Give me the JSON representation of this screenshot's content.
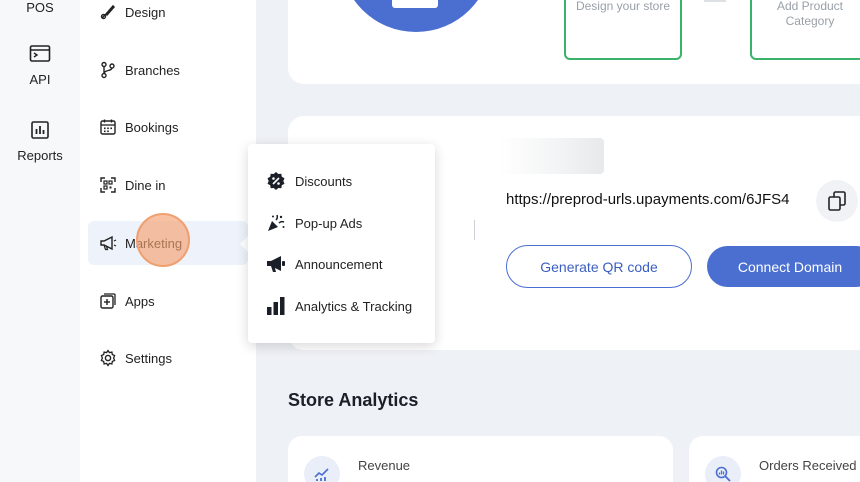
{
  "rail": {
    "items": [
      {
        "label": "POS",
        "icon": "pos-icon"
      },
      {
        "label": "API",
        "icon": "terminal-icon"
      },
      {
        "label": "Reports",
        "icon": "bar-chart-icon"
      }
    ]
  },
  "sidebar": {
    "items": [
      {
        "label": "Design",
        "icon": "brush-icon"
      },
      {
        "label": "Branches",
        "icon": "branch-icon"
      },
      {
        "label": "Bookings",
        "icon": "calendar-icon"
      },
      {
        "label": "Dine in",
        "icon": "qr-scan-icon"
      },
      {
        "label": "Marketing",
        "icon": "megaphone-icon",
        "active": true
      },
      {
        "label": "Apps",
        "icon": "add-app-icon"
      },
      {
        "label": "Settings",
        "icon": "gear-icon"
      }
    ]
  },
  "flyout": {
    "items": [
      {
        "label": "Discounts",
        "icon": "percent-badge-icon"
      },
      {
        "label": "Pop-up Ads",
        "icon": "confetti-icon"
      },
      {
        "label": "Announcement",
        "icon": "megaphone-icon"
      },
      {
        "label": "Analytics & Tracking",
        "icon": "bar-chart-icon"
      }
    ]
  },
  "top": {
    "design_store": "Design your store",
    "add_category": "Add Product Category"
  },
  "store": {
    "url": "https://preprod-urls.upayments.com/6JFS4",
    "qr_button": "Generate QR code",
    "domain_button": "Connect Domain"
  },
  "analytics": {
    "title": "Store Analytics",
    "cards": [
      {
        "label": "Revenue",
        "icon": "trend-chart-icon"
      },
      {
        "label": "Orders Received",
        "icon": "search-chart-icon"
      }
    ]
  },
  "colors": {
    "accent": "#4a6fd1",
    "green": "#3ab26a",
    "highlight": "#f4a070"
  }
}
